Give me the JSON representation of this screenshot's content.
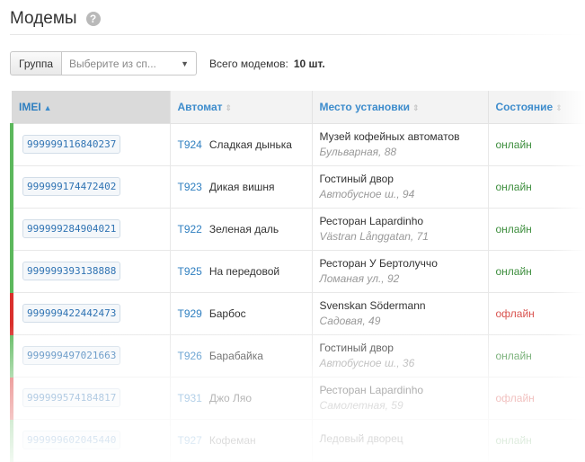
{
  "header": {
    "title": "Модемы",
    "help_icon": "question-circle-icon"
  },
  "filter": {
    "group_label": "Группа",
    "group_placeholder": "Выберите из сп...",
    "total_label": "Всего модемов:",
    "total_value": "10 шт."
  },
  "table": {
    "columns": [
      {
        "label": "IMEI",
        "sorted": true
      },
      {
        "label": "Автомат",
        "sorted": false
      },
      {
        "label": "Место установки",
        "sorted": false
      },
      {
        "label": "Состояние",
        "sorted": false
      }
    ],
    "rows": [
      {
        "imei": "999999116840237",
        "code": "T924",
        "machine": "Сладкая дынька",
        "place": "Музей кофейных автоматов",
        "address": "Бульварная, 88",
        "status": "онлайн",
        "online": true
      },
      {
        "imei": "999999174472402",
        "code": "T923",
        "machine": "Дикая вишня",
        "place": "Гостиный двор",
        "address": "Автобусное ш., 94",
        "status": "онлайн",
        "online": true
      },
      {
        "imei": "999999284904021",
        "code": "T922",
        "machine": "Зеленая даль",
        "place": "Ресторан Lapardinho",
        "address": "Västran Långgatan, 71",
        "status": "онлайн",
        "online": true
      },
      {
        "imei": "999999393138888",
        "code": "T925",
        "machine": "На передовой",
        "place": "Ресторан У Бертолуччо",
        "address": "Ломаная ул., 92",
        "status": "онлайн",
        "online": true
      },
      {
        "imei": "999999422442473",
        "code": "T929",
        "machine": "Барбос",
        "place": "Svenskan Södermann",
        "address": "Садовая, 49",
        "status": "офлайн",
        "online": false
      },
      {
        "imei": "999999497021663",
        "code": "T926",
        "machine": "Барабайка",
        "place": "Гостиный двор",
        "address": "Автобусное ш., 36",
        "status": "онлайн",
        "online": true
      },
      {
        "imei": "999999574184817",
        "code": "T931",
        "machine": "Джо Ляо",
        "place": "Ресторан Lapardinho",
        "address": "Самолетная, 59",
        "status": "офлайн",
        "online": false
      },
      {
        "imei": "999999602045440",
        "code": "T927",
        "machine": "Кофеман",
        "place": "Ледовый дворец",
        "address": "",
        "status": "онлайн",
        "online": true
      }
    ]
  },
  "colors": {
    "accent": "#3d8ccc",
    "online": "#5cb85c",
    "offline": "#d9302c"
  }
}
